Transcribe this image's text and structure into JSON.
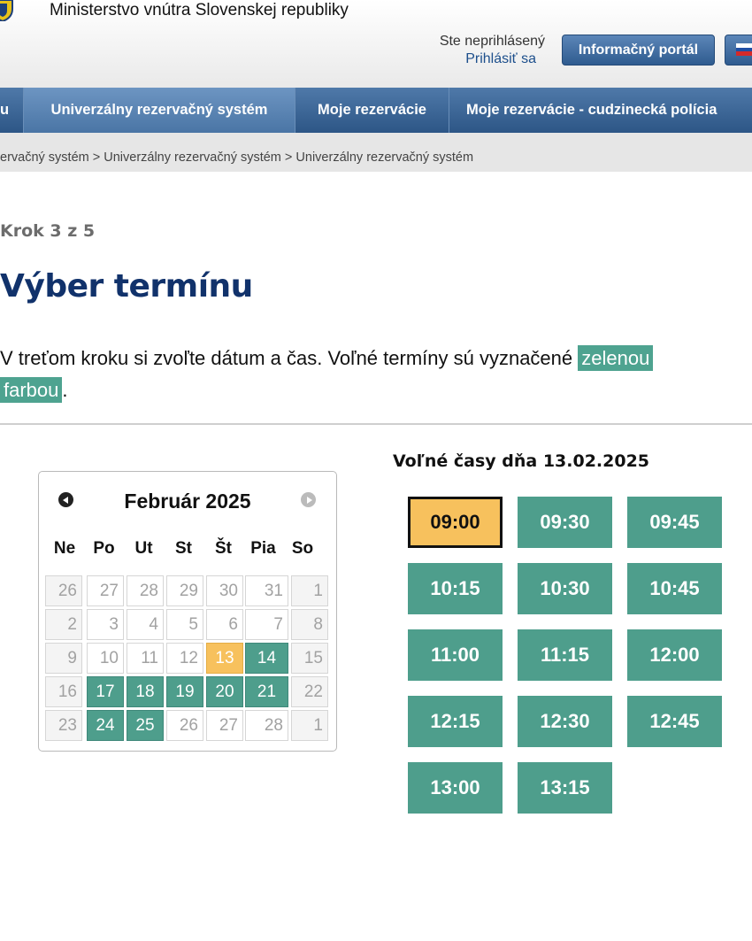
{
  "header": {
    "ministry": "Ministerstvo vnútra Slovenskej republiky",
    "login_status": "Ste neprihlásený",
    "login_link": "Prihlásiť sa",
    "portal_button": "Informačný portál"
  },
  "nav": {
    "items": [
      "u",
      "Univerzálny rezervačný systém",
      "Moje rezervácie",
      "Moje rezervácie - cudzinecká polícia"
    ]
  },
  "breadcrumb": "ervačný systém > Univerzálny rezervačný systém > Univerzálny rezervačný systém",
  "step": "Krok 3 z 5",
  "title": "Výber termínu",
  "intro": {
    "text": "V treťom kroku si zvoľte dátum a čas. Voľné termíny sú vyznačené ",
    "highlight_1": "zelenou",
    "highlight_2": "farbou",
    "end": "."
  },
  "calendar": {
    "title": "Február 2025",
    "weekdays": [
      "Ne",
      "Po",
      "Ut",
      "St",
      "Št",
      "Pia",
      "So"
    ],
    "weeks": [
      [
        "26",
        "27",
        "28",
        "29",
        "30",
        "31",
        "1"
      ],
      [
        "2",
        "3",
        "4",
        "5",
        "6",
        "7",
        "8"
      ],
      [
        "9",
        "10",
        "11",
        "12",
        "13",
        "14",
        "15"
      ],
      [
        "16",
        "17",
        "18",
        "19",
        "20",
        "21",
        "22"
      ],
      [
        "23",
        "24",
        "25",
        "26",
        "27",
        "28",
        "1"
      ]
    ],
    "selected_day": "13",
    "available_days": [
      "14",
      "17",
      "18",
      "19",
      "20",
      "21",
      "24",
      "25"
    ]
  },
  "times": {
    "title": "Voľné časy dňa 13.02.2025",
    "slots": [
      "09:00",
      "09:30",
      "09:45",
      "10:15",
      "10:30",
      "10:45",
      "11:00",
      "11:15",
      "12:00",
      "12:15",
      "12:30",
      "12:45",
      "13:00",
      "13:15"
    ],
    "selected": "09:00"
  },
  "colors": {
    "available": "#4e9e8c",
    "selected": "#f7c15d",
    "title": "#11326b",
    "nav": "#3a6496"
  }
}
